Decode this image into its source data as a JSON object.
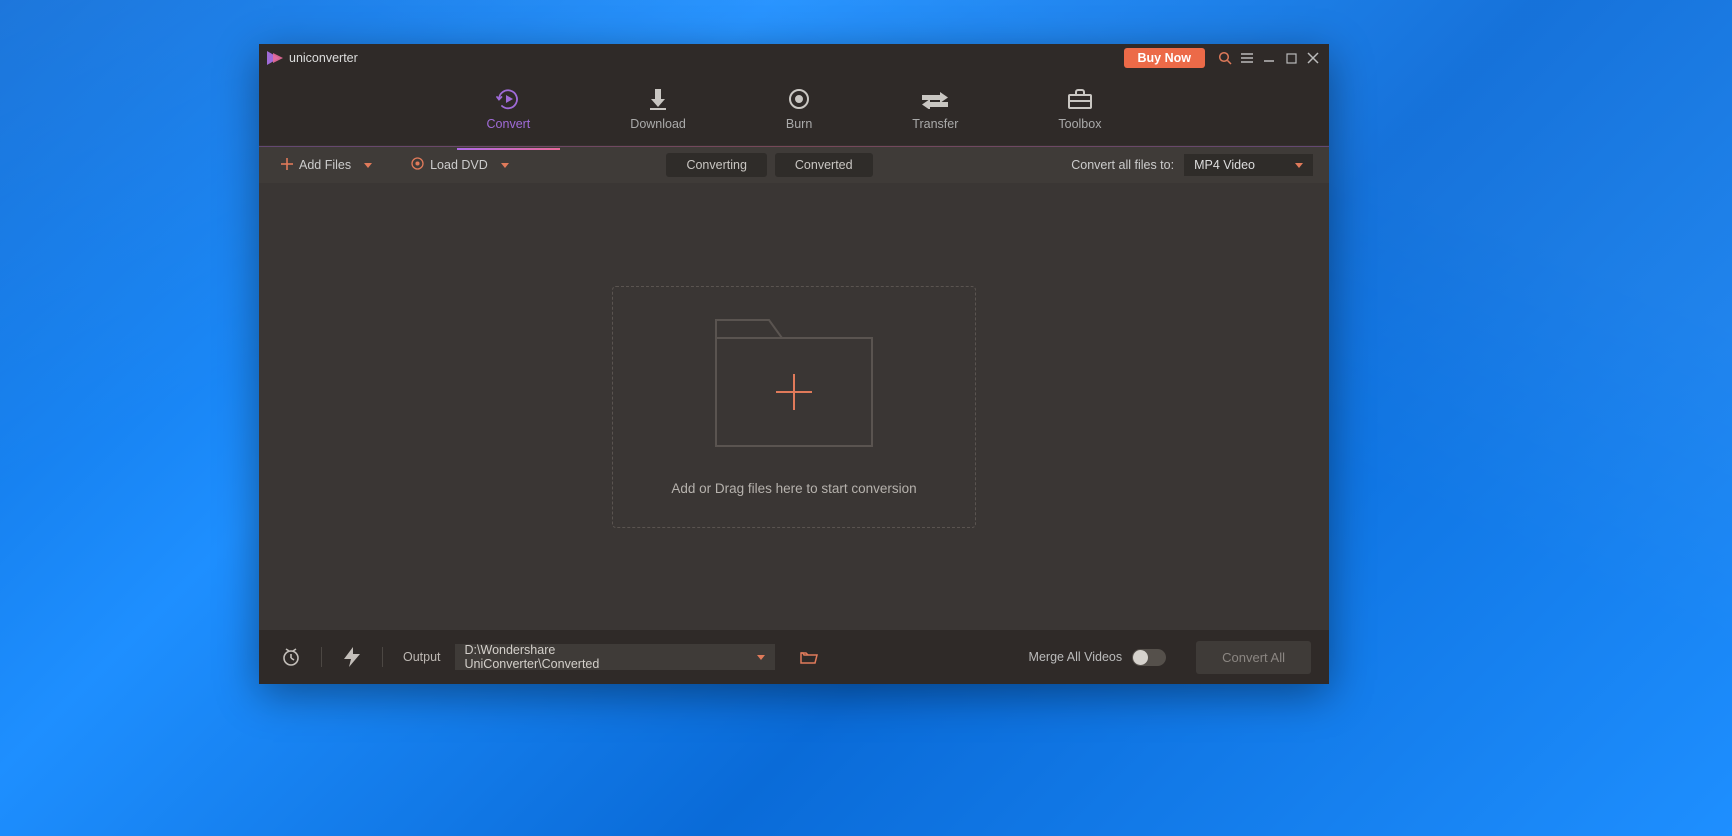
{
  "titlebar": {
    "app_name": "uniconverter",
    "buy_now": "Buy Now"
  },
  "nav": {
    "tabs": [
      {
        "id": "convert",
        "label": "Convert"
      },
      {
        "id": "download",
        "label": "Download"
      },
      {
        "id": "burn",
        "label": "Burn"
      },
      {
        "id": "transfer",
        "label": "Transfer"
      },
      {
        "id": "toolbox",
        "label": "Toolbox"
      }
    ],
    "active": "convert"
  },
  "sub_toolbar": {
    "add_files": "Add Files",
    "load_dvd": "Load DVD",
    "converting_tab": "Converting",
    "converted_tab": "Converted",
    "active_filter": "converting",
    "convert_all_label": "Convert all files to:",
    "target_format": "MP4 Video"
  },
  "dropzone": {
    "hint": "Add or Drag files here to start conversion"
  },
  "bottombar": {
    "output_label": "Output",
    "output_path": "D:\\Wondershare UniConverter\\Converted",
    "merge_label": "Merge All Videos",
    "merge_enabled": false,
    "convert_all_btn": "Convert All"
  },
  "colors": {
    "accent": "#a06bd8",
    "accent2": "#e86b9a",
    "warm": "#e07a5a"
  }
}
